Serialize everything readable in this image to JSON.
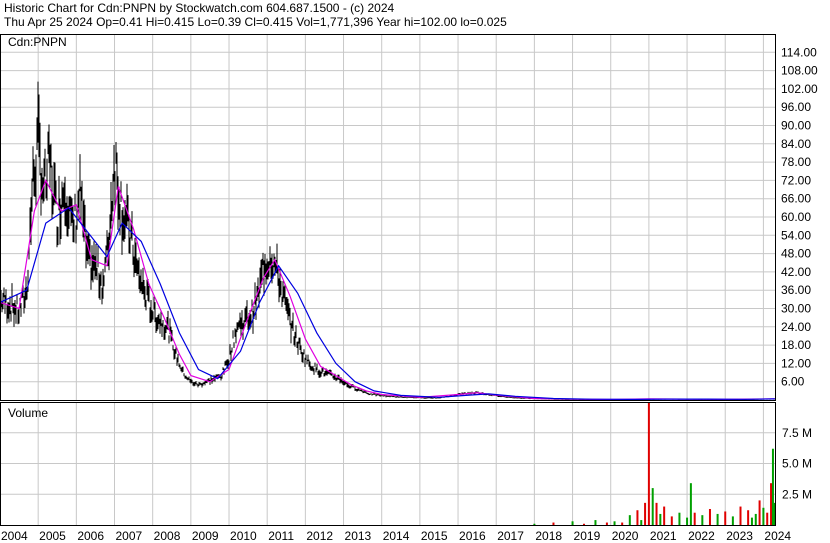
{
  "header": {
    "line1": "Historic Chart for Cdn:PNPN by Stockwatch.com 604.687.1500 - (c) 2024",
    "line2": "Thu Apr 25 2024   Op=0.41  Hi=0.415  Lo=0.39  Cl=0.415  Vol=1,771,396  Year hi=102.00  lo=0.025"
  },
  "colors": {
    "price_bar": "#000000",
    "volume_up": "#00a000",
    "volume_down": "#e00000",
    "ma_short": "#e000e0",
    "ma_long": "#0000e0",
    "grid": "#c8c8c8",
    "frame": "#000000"
  },
  "chart_data": [
    {
      "type": "line",
      "panel": "price",
      "symbol_label": "Cdn:PNPN",
      "ylim": [
        0,
        120
      ],
      "y_ticks": [
        "114.00",
        "108.00",
        "102.00",
        "96.00",
        "90.00",
        "84.00",
        "78.00",
        "72.00",
        "66.00",
        "60.00",
        "54.00",
        "48.00",
        "42.00",
        "36.00",
        "30.00",
        "24.00",
        "18.00",
        "12.00",
        "6.00"
      ],
      "x_ticks": [
        "2004",
        "2005",
        "2006",
        "2007",
        "2008",
        "2009",
        "2010",
        "2011",
        "2012",
        "2013",
        "2014",
        "2015",
        "2016",
        "2017",
        "2018",
        "2019",
        "2020",
        "2021",
        "2022",
        "2023",
        "2024"
      ],
      "x_range": [
        2004.0,
        2024.33
      ],
      "grid": true,
      "series": [
        {
          "role": "price-high-low",
          "x": [
            2004.0,
            2004.3,
            2004.5,
            2004.7,
            2004.85,
            2005.0,
            2005.15,
            2005.3,
            2005.5,
            2005.7,
            2005.9,
            2006.1,
            2006.3,
            2006.5,
            2006.7,
            2006.85,
            2007.0,
            2007.2,
            2007.4,
            2007.6,
            2007.8,
            2008.0,
            2008.2,
            2008.4,
            2008.6,
            2008.8,
            2009.0,
            2009.2,
            2009.4,
            2009.6,
            2009.8,
            2010.0,
            2010.2,
            2010.4,
            2010.6,
            2010.8,
            2010.9,
            2011.1,
            2011.3,
            2011.5,
            2011.7,
            2011.9,
            2012.1,
            2012.3,
            2012.5,
            2012.7,
            2012.9,
            2013.1,
            2013.3,
            2013.5,
            2013.7,
            2014.0,
            2014.5,
            2015.0,
            2015.5,
            2016.0,
            2016.5,
            2017.0,
            2017.5,
            2018.0,
            2018.5,
            2019.0,
            2019.5,
            2020.0,
            2020.5,
            2021.0,
            2021.5,
            2022.0,
            2022.5,
            2023.0,
            2023.5,
            2024.0,
            2024.3
          ],
          "y": [
            33,
            31,
            29,
            36,
            70,
            85,
            68,
            78,
            60,
            72,
            55,
            68,
            45,
            44,
            38,
            52,
            80,
            62,
            55,
            42,
            35,
            29,
            26,
            24,
            15,
            9,
            6,
            5,
            6,
            7,
            8,
            14,
            24,
            26,
            28,
            36,
            44,
            48,
            40,
            30,
            22,
            16,
            12,
            10,
            9,
            8,
            7,
            5,
            4,
            3,
            2,
            1.5,
            1.0,
            0.8,
            0.7,
            2.0,
            2.5,
            1.5,
            0.8,
            0.5,
            0.3,
            0.25,
            0.2,
            0.18,
            0.15,
            0.3,
            0.4,
            0.3,
            0.25,
            0.2,
            0.2,
            0.3,
            0.415
          ]
        },
        {
          "role": "moving-average-short",
          "x": [
            2004.0,
            2004.5,
            2004.9,
            2005.2,
            2005.6,
            2006.0,
            2006.4,
            2006.8,
            2007.1,
            2007.5,
            2007.9,
            2008.3,
            2008.7,
            2009.0,
            2009.5,
            2010.0,
            2010.5,
            2010.9,
            2011.2,
            2011.6,
            2012.0,
            2012.4,
            2012.8,
            2013.2,
            2013.6,
            2014.0,
            2015.0,
            2016.0,
            2016.5,
            2017.0,
            2018.0,
            2019.0,
            2020.0,
            2021.0,
            2022.0,
            2023.0,
            2024.3
          ],
          "y": [
            32,
            30,
            62,
            72,
            62,
            64,
            46,
            44,
            70,
            56,
            38,
            27,
            15,
            8,
            6,
            10,
            27,
            40,
            46,
            34,
            20,
            11,
            8,
            5,
            3,
            1.8,
            0.9,
            1.8,
            2.4,
            1.6,
            0.5,
            0.25,
            0.18,
            0.35,
            0.3,
            0.22,
            0.4
          ]
        },
        {
          "role": "moving-average-long",
          "x": [
            2004.0,
            2004.7,
            2005.2,
            2005.8,
            2006.3,
            2006.8,
            2007.2,
            2007.7,
            2008.2,
            2008.7,
            2009.2,
            2009.7,
            2010.3,
            2010.8,
            2011.3,
            2011.8,
            2012.3,
            2012.8,
            2013.3,
            2013.8,
            2014.5,
            2015.5,
            2016.3,
            2016.8,
            2017.5,
            2018.5,
            2019.5,
            2020.5,
            2021.5,
            2022.5,
            2023.5,
            2024.3
          ],
          "y": [
            32,
            36,
            58,
            63,
            55,
            47,
            58,
            52,
            38,
            22,
            10,
            7,
            16,
            32,
            44,
            35,
            22,
            12,
            6,
            3,
            1.5,
            0.9,
            1.6,
            2.0,
            1.2,
            0.5,
            0.25,
            0.2,
            0.3,
            0.28,
            0.24,
            0.35
          ]
        }
      ]
    },
    {
      "type": "bar",
      "panel": "volume",
      "title": "Volume",
      "ylim": [
        0,
        10
      ],
      "y_ticks": [
        "7.5 M",
        "5.0 M",
        "2.5 M"
      ],
      "grid": true,
      "x": [
        2018.0,
        2018.5,
        2019.0,
        2019.3,
        2019.6,
        2019.9,
        2020.1,
        2020.3,
        2020.5,
        2020.7,
        2020.8,
        2020.9,
        2021.0,
        2021.1,
        2021.2,
        2021.3,
        2021.4,
        2021.6,
        2021.8,
        2022.0,
        2022.1,
        2022.2,
        2022.4,
        2022.6,
        2022.8,
        2023.0,
        2023.2,
        2023.4,
        2023.6,
        2023.7,
        2023.8,
        2023.9,
        2024.0,
        2024.1,
        2024.2,
        2024.25,
        2024.3
      ],
      "values": [
        0.1,
        0.2,
        0.3,
        0.1,
        0.4,
        0.2,
        0.3,
        0.2,
        0.8,
        1.2,
        0.4,
        1.8,
        10.0,
        3.0,
        1.8,
        0.9,
        1.5,
        0.7,
        1.0,
        0.6,
        3.4,
        1.0,
        0.8,
        1.3,
        0.9,
        1.1,
        0.7,
        1.5,
        1.2,
        0.6,
        0.9,
        2.0,
        1.4,
        1.0,
        3.4,
        6.2,
        1.8
      ],
      "up": [
        true,
        false,
        true,
        false,
        true,
        false,
        true,
        false,
        true,
        false,
        true,
        false,
        false,
        true,
        false,
        true,
        false,
        false,
        true,
        true,
        true,
        false,
        true,
        false,
        true,
        false,
        true,
        false,
        false,
        true,
        true,
        false,
        true,
        false,
        false,
        true,
        true
      ]
    }
  ]
}
